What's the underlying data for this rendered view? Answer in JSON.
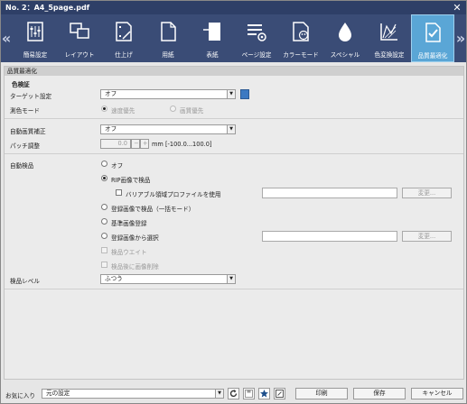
{
  "window": {
    "title": "No. 2：A4_5page.pdf"
  },
  "toolbar": {
    "items": [
      {
        "label": "簡易設定",
        "icon": "basic-settings-icon"
      },
      {
        "label": "レイアウト",
        "icon": "layout-icon"
      },
      {
        "label": "仕上げ",
        "icon": "finishing-icon"
      },
      {
        "label": "用紙",
        "icon": "paper-icon"
      },
      {
        "label": "表紙",
        "icon": "cover-icon"
      },
      {
        "label": "ページ設定",
        "icon": "page-settings-icon"
      },
      {
        "label": "カラーモード",
        "icon": "color-mode-icon"
      },
      {
        "label": "スペシャル",
        "icon": "special-icon"
      },
      {
        "label": "色変換設定",
        "icon": "color-conversion-icon"
      },
      {
        "label": "品質最適化",
        "icon": "quality-optimization-icon",
        "active": true
      }
    ]
  },
  "section": {
    "title": "品質最適化"
  },
  "color_check": {
    "heading": "色検証",
    "target_label": "ターゲット設定",
    "target_value": "オフ",
    "colorimetry_label": "測色モード",
    "colorimetry_options": [
      "速度優先",
      "画質優先"
    ]
  },
  "auto_correction": {
    "label": "自動画質補正",
    "value": "オフ",
    "patch_label": "パッチ調整",
    "patch_value": "0.0",
    "patch_unit": "mm [-100.0...100.0]"
  },
  "inspection": {
    "label": "自動検品",
    "options": [
      "オフ",
      "RIP画像で検品",
      "バリアブル領域プロファイルを使用",
      "登録画像で検品（一括モード）",
      "基準画像登録",
      "登録画像から選択",
      "検品ウエイト",
      "検品後に画像削除"
    ],
    "change_label": "変更...",
    "level_label": "検品レベル",
    "level_value": "ふつう"
  },
  "footer": {
    "favorites_label": "お気に入り",
    "favorites_value": "元の設定",
    "print_label": "印刷",
    "save_label": "保存",
    "cancel_label": "キャンセル"
  }
}
